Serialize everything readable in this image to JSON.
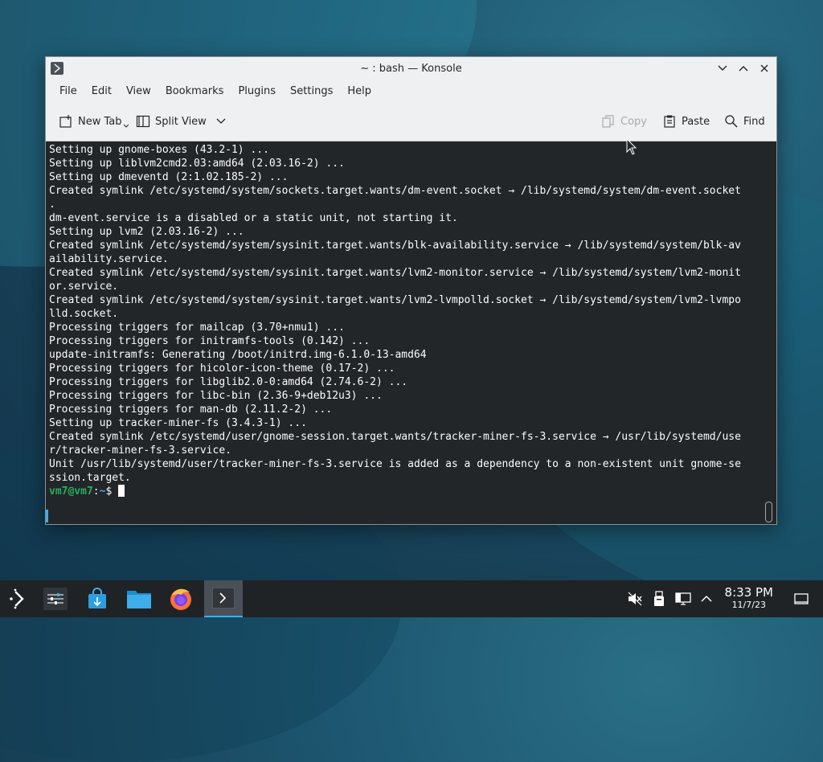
{
  "window": {
    "title": "~ : bash — Konsole"
  },
  "menu": [
    "File",
    "Edit",
    "View",
    "Bookmarks",
    "Plugins",
    "Settings",
    "Help"
  ],
  "toolbar": {
    "new_tab": "New Tab",
    "split_view": "Split View",
    "copy": "Copy",
    "paste": "Paste",
    "find": "Find"
  },
  "terminal": {
    "lines": [
      "Setting up gnome-boxes (43.2-1) ...",
      "Setting up liblvm2cmd2.03:amd64 (2.03.16-2) ...",
      "Setting up dmeventd (2:1.02.185-2) ...",
      "Created symlink /etc/systemd/system/sockets.target.wants/dm-event.socket → /lib/systemd/system/dm-event.socket",
      ".",
      "dm-event.service is a disabled or a static unit, not starting it.",
      "Setting up lvm2 (2.03.16-2) ...",
      "Created symlink /etc/systemd/system/sysinit.target.wants/blk-availability.service → /lib/systemd/system/blk-av",
      "ailability.service.",
      "Created symlink /etc/systemd/system/sysinit.target.wants/lvm2-monitor.service → /lib/systemd/system/lvm2-monit",
      "or.service.",
      "Created symlink /etc/systemd/system/sysinit.target.wants/lvm2-lvmpolld.socket → /lib/systemd/system/lvm2-lvmpo",
      "lld.socket.",
      "Processing triggers for mailcap (3.70+nmu1) ...",
      "Processing triggers for initramfs-tools (0.142) ...",
      "update-initramfs: Generating /boot/initrd.img-6.1.0-13-amd64",
      "Processing triggers for hicolor-icon-theme (0.17-2) ...",
      "Processing triggers for libglib2.0-0:amd64 (2.74.6-2) ...",
      "Processing triggers for libc-bin (2.36-9+deb12u3) ...",
      "Processing triggers for man-db (2.11.2-2) ...",
      "Setting up tracker-miner-fs (3.4.3-1) ...",
      "Created symlink /etc/systemd/user/gnome-session.target.wants/tracker-miner-fs-3.service → /usr/lib/systemd/use",
      "r/tracker-miner-fs-3.service.",
      "Unit /usr/lib/systemd/user/tracker-miner-fs-3.service is added as a dependency to a non-existent unit gnome-se",
      "ssion.target."
    ],
    "prompt_user": "vm7@vm7",
    "prompt_sep": ":",
    "prompt_path": "~",
    "prompt_symbol": "$ "
  },
  "taskbar": {
    "time": "8:33 PM",
    "date": "11/7/23"
  },
  "colors": {
    "prompt_user": "#27ae60",
    "prompt_path": "#3daee9",
    "terminal_bg": "#232629",
    "accent": "#3daee9"
  }
}
